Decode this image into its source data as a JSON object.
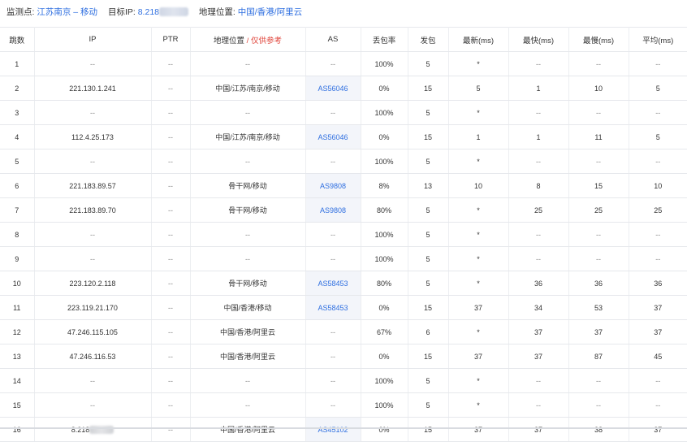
{
  "header": {
    "monitor_label": "监测点:",
    "monitor_value": "江苏南京 – 移动",
    "target_label": "目标IP:",
    "target_value": "8.218",
    "location_label": "地理位置:",
    "location_value": "中国/香港/阿里云"
  },
  "columns": {
    "hop": "跳数",
    "ip": "IP",
    "ptr": "PTR",
    "geo": "地理位置",
    "geo_sep": " / ",
    "geo_note": "仅供参考",
    "as": "AS",
    "loss": "丢包率",
    "sent": "发包",
    "last": "最新(ms)",
    "best": "最快(ms)",
    "worst": "最慢(ms)",
    "avg": "平均(ms)"
  },
  "rows": [
    {
      "hop": "1",
      "ip": "--",
      "ptr": "--",
      "geo": "--",
      "as": "--",
      "loss": "100%",
      "sent": "5",
      "last": "*",
      "best": "--",
      "worst": "--",
      "avg": "--"
    },
    {
      "hop": "2",
      "ip": "221.130.1.241",
      "ptr": "--",
      "geo": "中国/江苏/南京/移动",
      "as": "AS56046",
      "loss": "0%",
      "sent": "15",
      "last": "5",
      "best": "1",
      "worst": "10",
      "avg": "5"
    },
    {
      "hop": "3",
      "ip": "--",
      "ptr": "--",
      "geo": "--",
      "as": "--",
      "loss": "100%",
      "sent": "5",
      "last": "*",
      "best": "--",
      "worst": "--",
      "avg": "--"
    },
    {
      "hop": "4",
      "ip": "112.4.25.173",
      "ptr": "--",
      "geo": "中国/江苏/南京/移动",
      "as": "AS56046",
      "loss": "0%",
      "sent": "15",
      "last": "1",
      "best": "1",
      "worst": "11",
      "avg": "5"
    },
    {
      "hop": "5",
      "ip": "--",
      "ptr": "--",
      "geo": "--",
      "as": "--",
      "loss": "100%",
      "sent": "5",
      "last": "*",
      "best": "--",
      "worst": "--",
      "avg": "--"
    },
    {
      "hop": "6",
      "ip": "221.183.89.57",
      "ptr": "--",
      "geo": "骨干网/移动",
      "as": "AS9808",
      "loss": "8%",
      "sent": "13",
      "last": "10",
      "best": "8",
      "worst": "15",
      "avg": "10"
    },
    {
      "hop": "7",
      "ip": "221.183.89.70",
      "ptr": "--",
      "geo": "骨干网/移动",
      "as": "AS9808",
      "loss": "80%",
      "sent": "5",
      "last": "*",
      "best": "25",
      "worst": "25",
      "avg": "25"
    },
    {
      "hop": "8",
      "ip": "--",
      "ptr": "--",
      "geo": "--",
      "as": "--",
      "loss": "100%",
      "sent": "5",
      "last": "*",
      "best": "--",
      "worst": "--",
      "avg": "--"
    },
    {
      "hop": "9",
      "ip": "--",
      "ptr": "--",
      "geo": "--",
      "as": "--",
      "loss": "100%",
      "sent": "5",
      "last": "*",
      "best": "--",
      "worst": "--",
      "avg": "--"
    },
    {
      "hop": "10",
      "ip": "223.120.2.118",
      "ptr": "--",
      "geo": "骨干网/移动",
      "as": "AS58453",
      "loss": "80%",
      "sent": "5",
      "last": "*",
      "best": "36",
      "worst": "36",
      "avg": "36"
    },
    {
      "hop": "11",
      "ip": "223.119.21.170",
      "ptr": "--",
      "geo": "中国/香港/移动",
      "as": "AS58453",
      "loss": "0%",
      "sent": "15",
      "last": "37",
      "best": "34",
      "worst": "53",
      "avg": "37"
    },
    {
      "hop": "12",
      "ip": "47.246.115.105",
      "ptr": "--",
      "geo": "中国/香港/阿里云",
      "as": "--",
      "loss": "67%",
      "sent": "6",
      "last": "*",
      "best": "37",
      "worst": "37",
      "avg": "37"
    },
    {
      "hop": "13",
      "ip": "47.246.116.53",
      "ptr": "--",
      "geo": "中国/香港/阿里云",
      "as": "--",
      "loss": "0%",
      "sent": "15",
      "last": "37",
      "best": "37",
      "worst": "87",
      "avg": "45"
    },
    {
      "hop": "14",
      "ip": "--",
      "ptr": "--",
      "geo": "--",
      "as": "--",
      "loss": "100%",
      "sent": "5",
      "last": "*",
      "best": "--",
      "worst": "--",
      "avg": "--"
    },
    {
      "hop": "15",
      "ip": "--",
      "ptr": "--",
      "geo": "--",
      "as": "--",
      "loss": "100%",
      "sent": "5",
      "last": "*",
      "best": "--",
      "worst": "--",
      "avg": "--"
    },
    {
      "hop": "16",
      "ip": "8.218",
      "ip_blurred": true,
      "ptr": "--",
      "geo": "中国/香港/阿里云",
      "as": "AS45102",
      "loss": "0%",
      "sent": "15",
      "last": "37",
      "best": "37",
      "worst": "38",
      "avg": "37"
    }
  ],
  "colors": {
    "link": "#2f6fe0",
    "note_red": "#e0463c",
    "as_cell_bg": "#f3f5fa"
  }
}
